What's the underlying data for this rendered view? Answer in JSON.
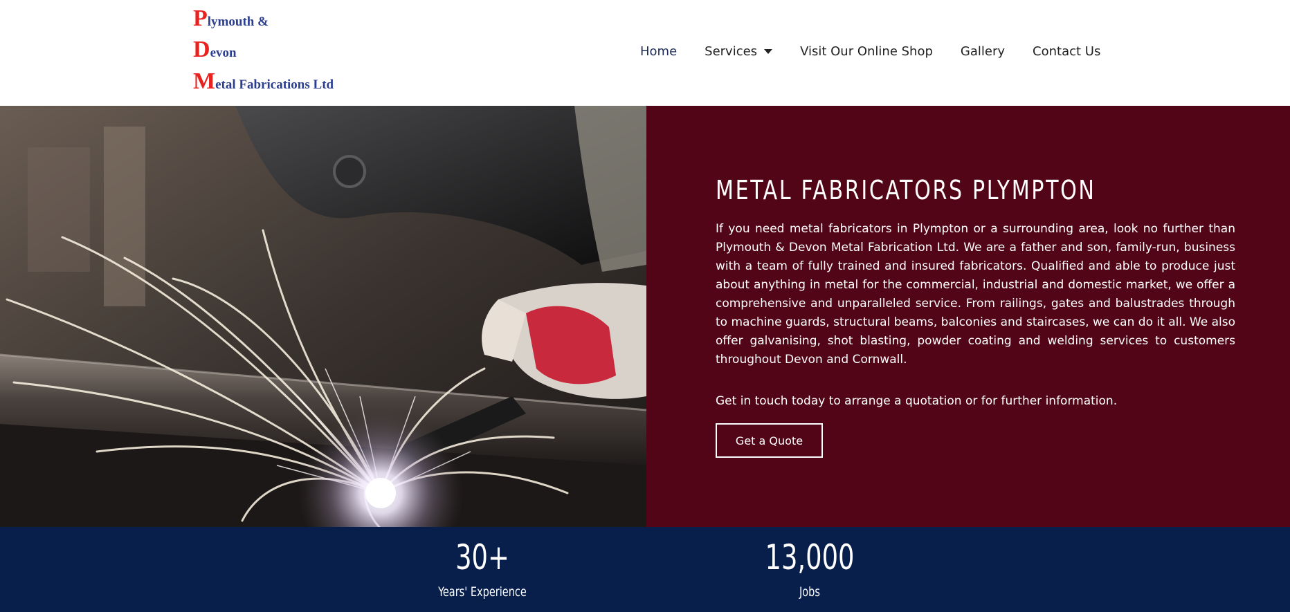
{
  "logo": {
    "line1_cap": "P",
    "line1_rest": "lymouth &",
    "line2_cap": "D",
    "line2_rest": "evon",
    "line3_cap": "M",
    "line3_rest": "etal Fabrications Ltd",
    "colors": {
      "capital": "#e8231f",
      "text": "#2c3f8f"
    }
  },
  "nav": {
    "items": [
      {
        "label": "Home",
        "active": true
      },
      {
        "label": "Services",
        "has_dropdown": true
      },
      {
        "label": "Visit Our Online Shop"
      },
      {
        "label": "Gallery"
      },
      {
        "label": "Contact Us"
      }
    ]
  },
  "hero": {
    "image": "welding-sparks-photo",
    "title": "METAL FABRICATORS PLYMPTON",
    "body": "If you need metal fabricators in Plympton or a surrounding area, look no further than Plymouth & Devon Metal Fabrication Ltd. We are a father and son, family-run, business with a team of fully trained and insured fabricators. Qualified and able to produce just about anything in metal for the commercial, industrial and domestic market, we offer a comprehensive and unparalleled service. From railings, gates and balustrades through to machine guards, structural beams, balconies and staircases, we can do it all. We also offer galvanising, shot blasting, powder coating and welding services to customers throughout Devon and Cornwall.",
    "cta_text": "Get in touch today to arrange a quotation or for further information.",
    "button_label": "Get a Quote",
    "background_color": "#520516"
  },
  "stats": {
    "background_color": "#081e4b",
    "items": [
      {
        "value": "30+",
        "label": "Years' Experience"
      },
      {
        "value": "13,000",
        "label": "Jobs"
      }
    ]
  }
}
